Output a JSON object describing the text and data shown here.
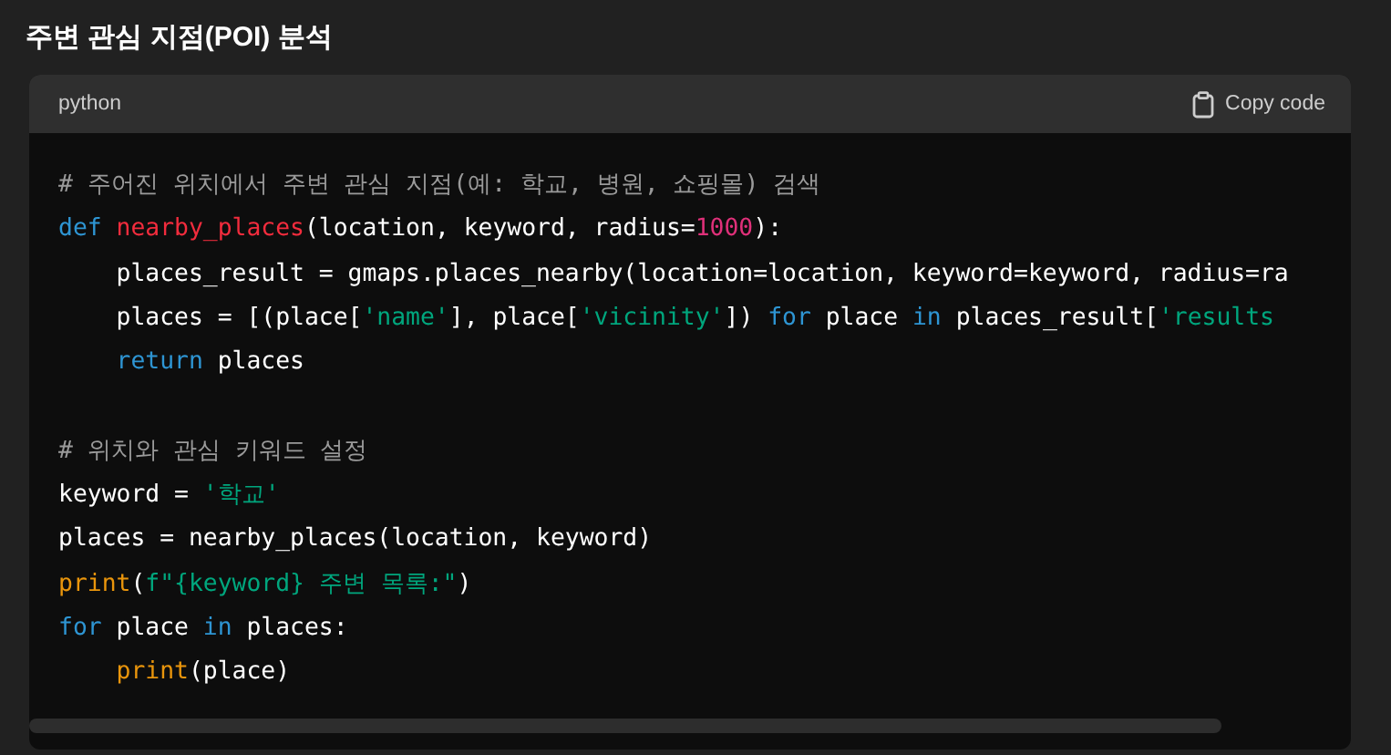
{
  "heading": "주변 관심 지점(POI) 분석",
  "code_block": {
    "language": "python",
    "copy_button": "Copy code",
    "lines": [
      {
        "kind": "code",
        "indent": false,
        "tokens": [
          {
            "kind": "comment",
            "text": "# 주어진 위치에서 주변 관심 지점(예: 학교, 병원, 쇼핑몰) 검색"
          }
        ]
      },
      {
        "kind": "code",
        "indent": false,
        "tokens": [
          {
            "kind": "keyword",
            "text": "def"
          },
          {
            "kind": "function",
            "text": " nearby_places"
          },
          {
            "kind": "plain",
            "text": "(location, keyword, radius="
          },
          {
            "kind": "number",
            "text": "1000"
          },
          {
            "kind": "plain",
            "text": "):"
          }
        ]
      },
      {
        "kind": "code",
        "indent": true,
        "tokens": [
          {
            "kind": "plain",
            "text": "places_result = gmaps.places_nearby(location=location, keyword=keyword, radius=ra"
          }
        ]
      },
      {
        "kind": "code",
        "indent": true,
        "tokens": [
          {
            "kind": "plain",
            "text": "places = [(place["
          },
          {
            "kind": "string",
            "text": "'name'"
          },
          {
            "kind": "plain",
            "text": "], place["
          },
          {
            "kind": "string",
            "text": "'vicinity'"
          },
          {
            "kind": "plain",
            "text": "]) "
          },
          {
            "kind": "keyword",
            "text": "for"
          },
          {
            "kind": "plain",
            "text": " place "
          },
          {
            "kind": "keyword",
            "text": "in"
          },
          {
            "kind": "plain",
            "text": " places_result["
          },
          {
            "kind": "string",
            "text": "'results"
          }
        ]
      },
      {
        "kind": "code",
        "indent": true,
        "tokens": [
          {
            "kind": "keyword",
            "text": "return"
          },
          {
            "kind": "plain",
            "text": " places"
          }
        ]
      },
      {
        "kind": "blank"
      },
      {
        "kind": "code",
        "indent": false,
        "tokens": [
          {
            "kind": "comment",
            "text": "# 위치와 관심 키워드 설정"
          }
        ]
      },
      {
        "kind": "code",
        "indent": false,
        "tokens": [
          {
            "kind": "plain",
            "text": "keyword = "
          },
          {
            "kind": "string",
            "text": "'학교'"
          }
        ]
      },
      {
        "kind": "code",
        "indent": false,
        "tokens": [
          {
            "kind": "plain",
            "text": "places = nearby_places(location, keyword)"
          }
        ]
      },
      {
        "kind": "code",
        "indent": false,
        "tokens": [
          {
            "kind": "builtin",
            "text": "print"
          },
          {
            "kind": "plain",
            "text": "("
          },
          {
            "kind": "string",
            "text": "f\"{keyword} 주변 목록:\""
          },
          {
            "kind": "plain",
            "text": ")"
          }
        ]
      },
      {
        "kind": "code",
        "indent": false,
        "tokens": [
          {
            "kind": "keyword",
            "text": "for"
          },
          {
            "kind": "plain",
            "text": " place "
          },
          {
            "kind": "keyword",
            "text": "in"
          },
          {
            "kind": "plain",
            "text": " places:"
          }
        ]
      },
      {
        "kind": "code",
        "indent": true,
        "tokens": [
          {
            "kind": "builtin",
            "text": "print"
          },
          {
            "kind": "plain",
            "text": "(place)"
          }
        ]
      }
    ]
  }
}
